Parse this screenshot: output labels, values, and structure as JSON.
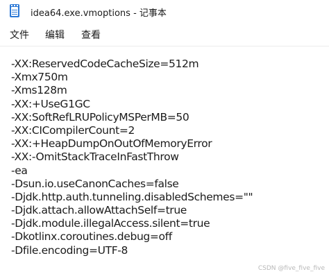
{
  "window": {
    "title": "idea64.exe.vmoptions - 记事本",
    "app_icon": "notepad-icon"
  },
  "menubar": {
    "items": [
      "文件",
      "编辑",
      "查看"
    ]
  },
  "editor": {
    "lines": [
      "-XX:ReservedCodeCacheSize=512m",
      "-Xmx750m",
      "-Xms128m",
      "-XX:+UseG1GC",
      "-XX:SoftRefLRUPolicyMSPerMB=50",
      "-XX:CICompilerCount=2",
      "-XX:+HeapDumpOnOutOfMemoryError",
      "-XX:-OmitStackTraceInFastThrow",
      "-ea",
      "-Dsun.io.useCanonCaches=false",
      "-Djdk.http.auth.tunneling.disabledSchemes=\"\"",
      "-Djdk.attach.allowAttachSelf=true",
      "-Djdk.module.illegalAccess.silent=true",
      "-Dkotlinx.coroutines.debug=off",
      "-Dfile.encoding=UTF-8"
    ]
  },
  "watermark": "CSDN @five_five_five",
  "colors": {
    "background": "#ffffff",
    "text": "#1b1b1b",
    "icon_accent": "#2a78d6"
  }
}
